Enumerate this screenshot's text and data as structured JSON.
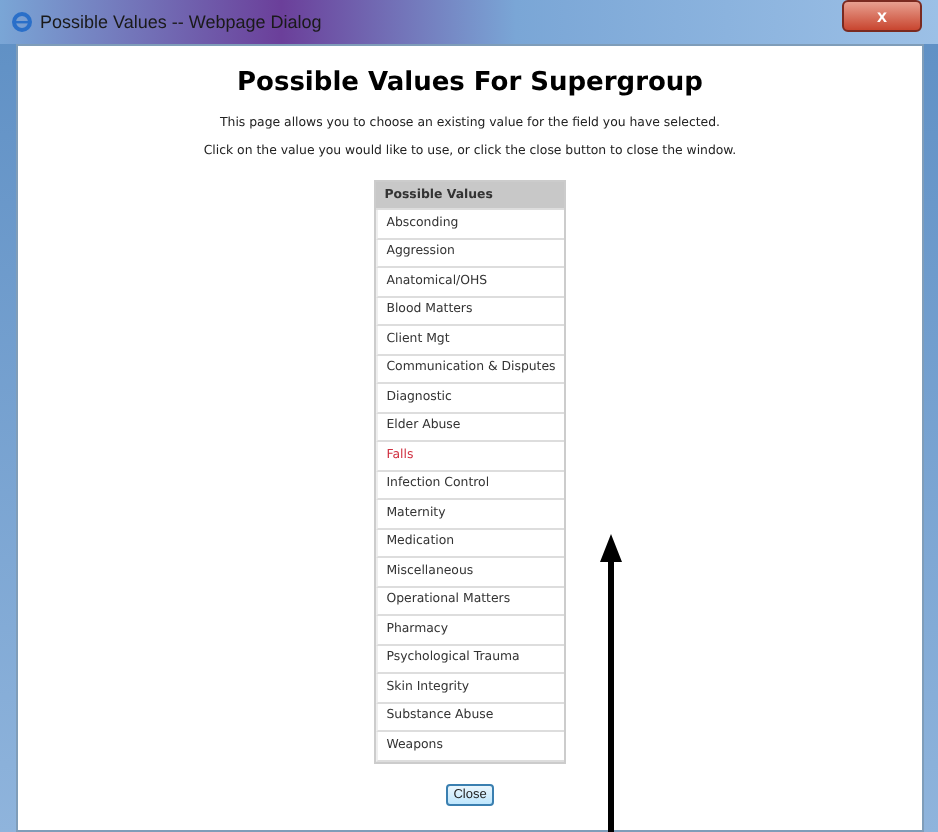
{
  "window": {
    "title": "Possible Values  -- Webpage Dialog",
    "close_label": "x"
  },
  "heading": "Possible Values For Supergroup",
  "instructions": [
    "This page allows you to choose an existing value for the field you have selected.",
    "Click on the value you would like to use, or click the close button to close the window."
  ],
  "table": {
    "column": "Possible Values",
    "rows": [
      {
        "label": "Absconding",
        "selected": false
      },
      {
        "label": "Aggression",
        "selected": false
      },
      {
        "label": "Anatomical/OHS",
        "selected": false
      },
      {
        "label": "Blood Matters",
        "selected": false
      },
      {
        "label": "Client Mgt",
        "selected": false
      },
      {
        "label": "Communication & Disputes",
        "selected": false
      },
      {
        "label": "Diagnostic",
        "selected": false
      },
      {
        "label": "Elder Abuse",
        "selected": false
      },
      {
        "label": "Falls",
        "selected": true
      },
      {
        "label": "Infection Control",
        "selected": false
      },
      {
        "label": "Maternity",
        "selected": false
      },
      {
        "label": "Medication",
        "selected": false
      },
      {
        "label": "Miscellaneous",
        "selected": false
      },
      {
        "label": "Operational Matters",
        "selected": false
      },
      {
        "label": "Pharmacy",
        "selected": false
      },
      {
        "label": "Psychological Trauma",
        "selected": false
      },
      {
        "label": "Skin Integrity",
        "selected": false
      },
      {
        "label": "Substance Abuse",
        "selected": false
      },
      {
        "label": "Weapons",
        "selected": false
      }
    ]
  },
  "close_button": "Close"
}
